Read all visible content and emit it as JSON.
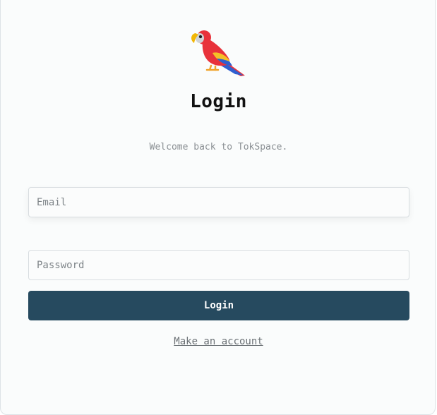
{
  "logo": {
    "icon": "parrot-icon"
  },
  "header": {
    "title": "Login",
    "subtitle": "Welcome back to TokSpace."
  },
  "form": {
    "email": {
      "placeholder": "Email",
      "value": ""
    },
    "password": {
      "placeholder": "Password",
      "value": ""
    },
    "submit_label": "Login"
  },
  "footer": {
    "register_link": "Make an account"
  },
  "colors": {
    "button_bg": "#264a5f",
    "button_text": "#ffffff",
    "card_bg": "#fafcfc",
    "subtitle_text": "#8a8f93"
  }
}
